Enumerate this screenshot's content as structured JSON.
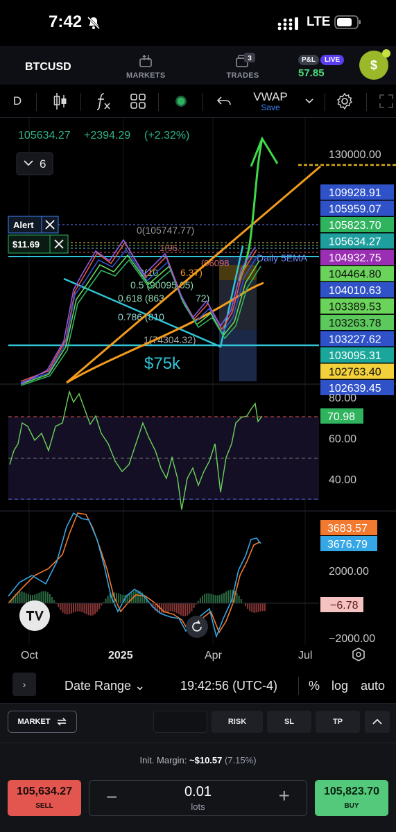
{
  "status_bar": {
    "time": "7:42",
    "network": "LTE"
  },
  "top_nav": {
    "symbol": "BTCUSD",
    "markets_label": "MARKETS",
    "trades_label": "TRADES",
    "trades_badge": "3",
    "pl_label": "P&L",
    "live_label": "LIVE",
    "pl_value": "57.85",
    "avatar_text": "$"
  },
  "toolbar": {
    "interval": "D",
    "layout_name": "VWAP",
    "save_label": "Save",
    "icons": [
      "candles-icon",
      "fx-indicators-icon",
      "grid-layout-icon",
      "record-dot-icon",
      "undo-icon",
      "chevron-down-icon",
      "gear-icon",
      "fullscreen-icon"
    ]
  },
  "chart": {
    "header_price": "105634.27",
    "header_change": "+2394.29",
    "header_change_pct": "(+2.32%)",
    "layers_count": "6",
    "alert_label": "Alert",
    "alert_value": "$11.69",
    "target_line_label": "130000.00",
    "price_labels": [
      {
        "text": "109928.91",
        "color": "#2f52c8"
      },
      {
        "text": "105959.07",
        "color": "#2f52c8"
      },
      {
        "text": "105823.70",
        "color": "#2fb35d"
      },
      {
        "text": "105634.27",
        "color": "#1f9e9e"
      },
      {
        "text": "104932.75",
        "color": "#9b2fb3"
      },
      {
        "text": "104464.80",
        "color": "#6ad35a"
      },
      {
        "text": "104010.63",
        "color": "#2f52c8"
      },
      {
        "text": "103389.53",
        "color": "#6ad35a"
      },
      {
        "text": "103263.78",
        "color": "#5bc95b"
      },
      {
        "text": "103227.62",
        "color": "#2f52c8"
      },
      {
        "text": "103095.31",
        "color": "#1aa69a"
      },
      {
        "text": "102763.40",
        "color": "#f2d13a"
      },
      {
        "text": "102639.45",
        "color": "#2f52c8"
      }
    ],
    "fib_labels": [
      "0(105747.77)",
      "0.5 (90095.05)",
      "0.618 (863",
      "0.786 (810",
      "1(74304.32)"
    ],
    "fib_fragments": [
      "1(96...",
      "3(10",
      "6.37)",
      "(96098",
      "72)"
    ],
    "daily_ema_label": "Daily 5EMA",
    "support_label": "$75k",
    "rsi_axis": [
      "80.00",
      "60.00",
      "40.00"
    ],
    "rsi_value": "70.98",
    "macd_axis": [
      "2000.00",
      "−2000.00"
    ],
    "macd_value_1": "3683.57",
    "macd_value_2": "3676.79",
    "macd_hist_value": "−6.78",
    "time_axis": [
      "Oct",
      "2025",
      "Apr",
      "Jul"
    ],
    "colors": {
      "up": "#2fb35d",
      "down": "#e3564f",
      "ema_orange": "#f29b1d",
      "accent_blue": "#3b82f6",
      "arrow_green": "#3fd94a",
      "target_gold": "#d9ad1a"
    }
  },
  "date_bar": {
    "collapse_label": "›",
    "date_range_label": "Date Range",
    "clock": "19:42:56 (UTC-4)",
    "percent_label": "%",
    "log_label": "log",
    "auto_label": "auto"
  },
  "order_panel": {
    "market_label": "MARKET",
    "risk_label": "RISK",
    "sl_label": "SL",
    "tp_label": "TP",
    "init_margin_label": "Init. Margin:",
    "init_margin_value": "~$10.57",
    "init_margin_pct": "(7.15%)",
    "sell_price": "105,634.27",
    "sell_label": "SELL",
    "buy_price": "105,823.70",
    "buy_label": "BUY",
    "lots_value": "0.01",
    "lots_unit": "lots"
  }
}
